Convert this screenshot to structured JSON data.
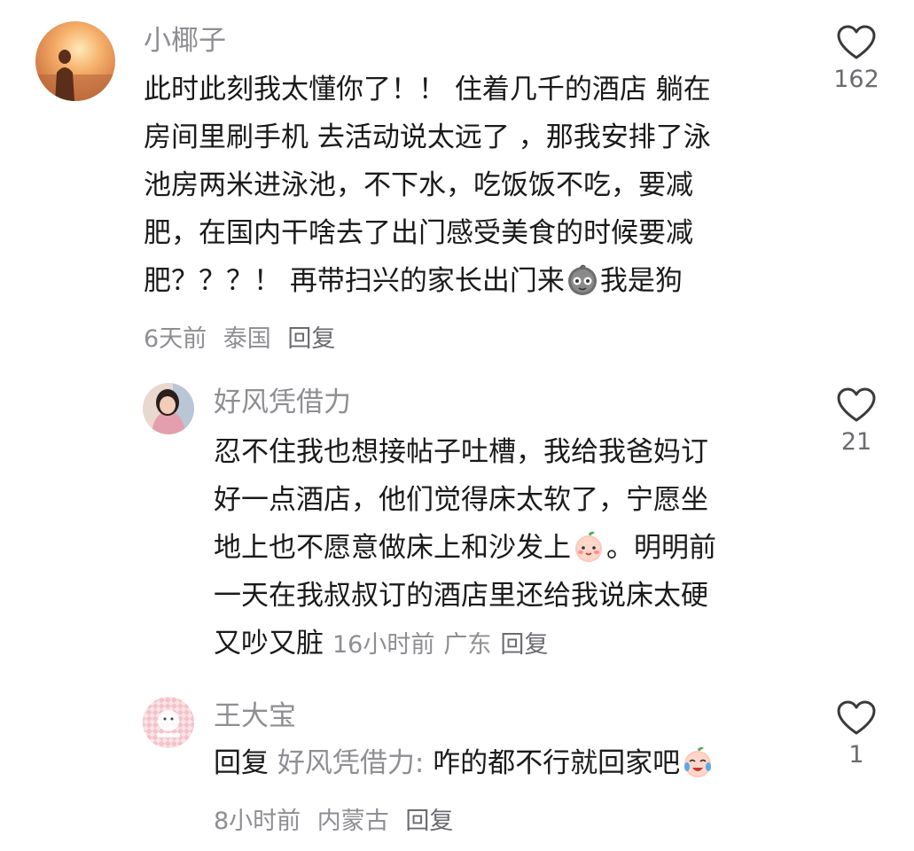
{
  "comments": [
    {
      "author": "小椰子",
      "lines": [
        "此时此刻我太懂你了！！ 住着几千的酒店 躺在",
        "房间里刷手机 去活动说太远了 ，那我安排了泳",
        "池房两米进泳池，不下水，吃饭饭不吃，要减",
        "肥，在国内干啥去了出门感受美食的时候要减"
      ],
      "last_line_before_emoji": "肥？？？！ 再带扫兴的家长出门来",
      "last_line_after_emoji": "我是狗",
      "emoji": "smiling-face-emoji",
      "time": "6天前",
      "location": "泰国",
      "reply_label": "回复",
      "likes": "162"
    },
    {
      "author": "好风凭借力",
      "line1": "忍不住我也想接帖子吐槽，我给我爸妈订",
      "line2": "好一点酒店，他们觉得床太软了，宁愿坐",
      "line3_before_emoji": "地上也不愿意做床上和沙发上",
      "line3_after_emoji": "。明明前",
      "line4": "一天在我叔叔订的酒店里还给我说床太硬",
      "line5": "又吵又脏",
      "emoji": "peach-face-emoji",
      "time": "16小时前",
      "location": "广东",
      "reply_label": "回复",
      "likes": "21"
    },
    {
      "author": "王大宝",
      "reply_prefix": "回复",
      "mention": "好风凭借力:",
      "text": " 咋的都不行就回家吧",
      "emoji": "crying-laughing-emoji",
      "time": "8小时前",
      "location": "内蒙古",
      "reply_label": "回复",
      "likes": "1"
    }
  ],
  "colors": {
    "text": "#1a1a1a",
    "secondary": "#8e8e93",
    "background": "#ffffff"
  }
}
